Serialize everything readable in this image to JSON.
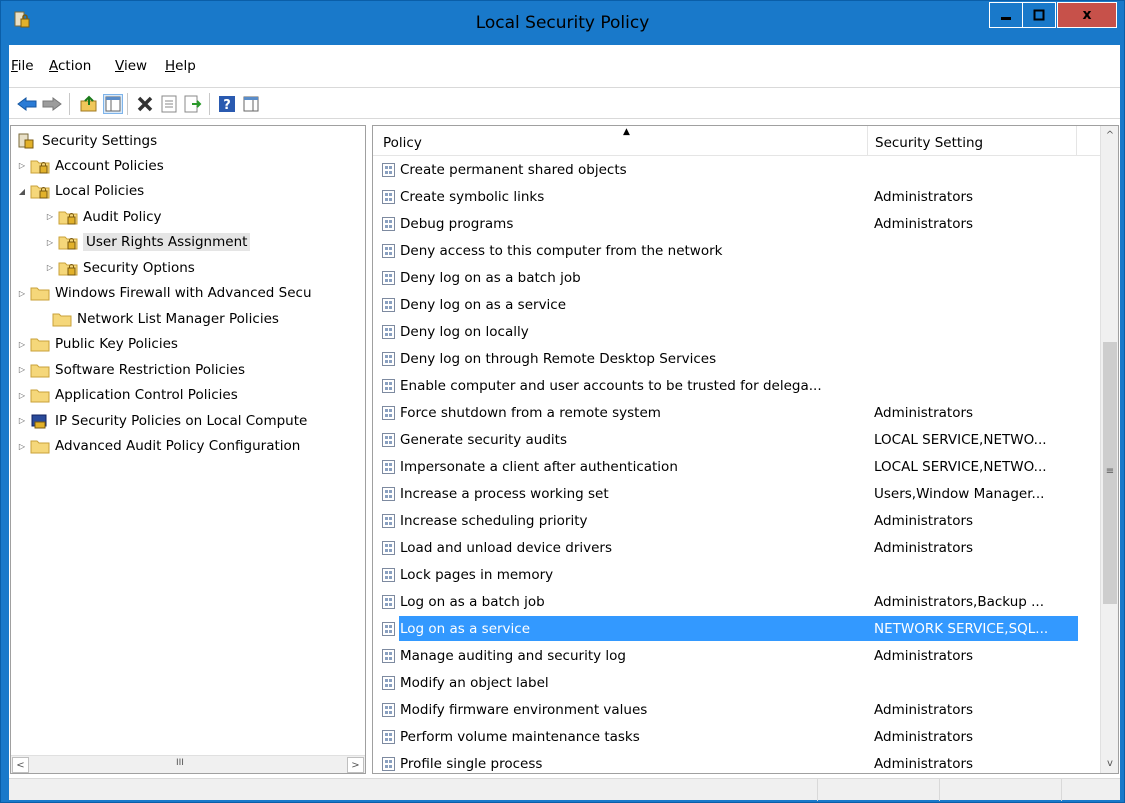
{
  "window": {
    "title": "Local Security Policy",
    "close_label": "x",
    "icon": "local-security-policy-icon",
    "colors": {
      "titlebar": "#1979ca",
      "close": "#c7514a",
      "selection": "#3399ff"
    }
  },
  "menu": [
    {
      "accel": "F",
      "rest": "ile"
    },
    {
      "accel": "A",
      "rest": "ction"
    },
    {
      "accel": "V",
      "rest": "iew"
    },
    {
      "accel": "H",
      "rest": "elp"
    }
  ],
  "toolbar": [
    "back-icon",
    "forward-icon",
    "up-folder-icon",
    "show-hide-console-tree-icon",
    "delete-icon",
    "properties-icon",
    "export-list-icon",
    "help-icon",
    "action-pane-icon"
  ],
  "tree": {
    "root": "Security Settings",
    "items": [
      {
        "label": "Account Policies",
        "expander": "▷",
        "lock": true
      },
      {
        "label": "Local Policies",
        "expander": "◢",
        "lock": true
      },
      {
        "label": "Audit Policy",
        "expander": "▷",
        "lock": true
      },
      {
        "label": "User Rights Assignment",
        "expander": "▷",
        "lock": true,
        "selected": true
      },
      {
        "label": "Security Options",
        "expander": "▷",
        "lock": true
      },
      {
        "label": "Windows Firewall with Advanced Secu",
        "expander": "▷",
        "lock": false
      },
      {
        "label": "Network List Manager Policies",
        "expander": "",
        "lock": false
      },
      {
        "label": "Public Key Policies",
        "expander": "▷",
        "lock": false
      },
      {
        "label": "Software Restriction Policies",
        "expander": "▷",
        "lock": false
      },
      {
        "label": "Application Control Policies",
        "expander": "▷",
        "lock": false
      },
      {
        "label": "IP Security Policies on Local Compute",
        "expander": "▷",
        "lock": false,
        "special": true
      },
      {
        "label": "Advanced Audit Policy Configuration",
        "expander": "▷",
        "lock": false
      }
    ],
    "scroll_grip": "III"
  },
  "list": {
    "columns": {
      "policy": "Policy",
      "setting": "Security Setting"
    },
    "rows": [
      {
        "policy": "Create permanent shared objects",
        "setting": ""
      },
      {
        "policy": "Create symbolic links",
        "setting": "Administrators"
      },
      {
        "policy": "Debug programs",
        "setting": "Administrators"
      },
      {
        "policy": "Deny access to this computer from the network",
        "setting": ""
      },
      {
        "policy": "Deny log on as a batch job",
        "setting": ""
      },
      {
        "policy": "Deny log on as a service",
        "setting": ""
      },
      {
        "policy": "Deny log on locally",
        "setting": ""
      },
      {
        "policy": "Deny log on through Remote Desktop Services",
        "setting": ""
      },
      {
        "policy": "Enable computer and user accounts to be trusted for delega...",
        "setting": ""
      },
      {
        "policy": "Force shutdown from a remote system",
        "setting": "Administrators"
      },
      {
        "policy": "Generate security audits",
        "setting": "LOCAL SERVICE,NETWO..."
      },
      {
        "policy": "Impersonate a client after authentication",
        "setting": "LOCAL SERVICE,NETWO..."
      },
      {
        "policy": "Increase a process working set",
        "setting": "Users,Window Manager..."
      },
      {
        "policy": "Increase scheduling priority",
        "setting": "Administrators"
      },
      {
        "policy": "Load and unload device drivers",
        "setting": "Administrators"
      },
      {
        "policy": "Lock pages in memory",
        "setting": ""
      },
      {
        "policy": "Log on as a batch job",
        "setting": "Administrators,Backup ..."
      },
      {
        "policy": "Log on as a service",
        "setting": "NETWORK SERVICE,SQL...",
        "selected": true
      },
      {
        "policy": "Manage auditing and security log",
        "setting": "Administrators"
      },
      {
        "policy": "Modify an object label",
        "setting": ""
      },
      {
        "policy": "Modify firmware environment values",
        "setting": "Administrators"
      },
      {
        "policy": "Perform volume maintenance tasks",
        "setting": "Administrators"
      },
      {
        "policy": "Profile single process",
        "setting": "Administrators"
      }
    ],
    "scroll_grip": "≡"
  }
}
